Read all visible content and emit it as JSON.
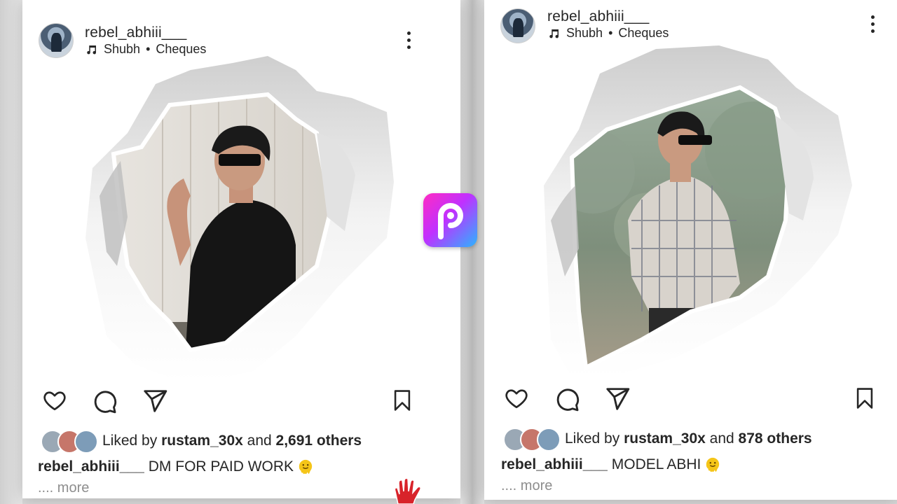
{
  "posts": [
    {
      "username": "rebel_abhiii___",
      "audio_artist": "Shubh",
      "audio_sep": "•",
      "audio_track": "Cheques",
      "liked_prefix": "Liked by",
      "liked_user": "rustam_30x",
      "liked_and": "and",
      "liked_count": "2,691 others",
      "caption_user": "rebel_abhiii___",
      "caption_text": "DM FOR PAID WORK",
      "more_text": ".... more",
      "icons": [
        "heart-icon",
        "comment-icon",
        "share-icon",
        "bookmark-icon",
        "more-vertical-icon",
        "music-icon"
      ]
    },
    {
      "username": "rebel_abhiii___",
      "audio_artist": "Shubh",
      "audio_sep": "•",
      "audio_track": "Cheques",
      "liked_prefix": "Liked by",
      "liked_user": "rustam_30x",
      "liked_and": "and",
      "liked_count": "878 others",
      "caption_user": "rebel_abhiii___",
      "caption_text": "MODEL ABHI",
      "more_text": ".... more",
      "icons": [
        "heart-icon",
        "comment-icon",
        "share-icon",
        "bookmark-icon",
        "more-vertical-icon",
        "music-icon"
      ]
    }
  ],
  "overlay": {
    "logo": "picsart-logo-icon",
    "sticker": "hand-sticker-icon"
  },
  "colors": {
    "text": "#262626",
    "muted": "#8e8e8e",
    "logo_gradient_start": "#ff2bc2",
    "logo_gradient_end": "#2ab5ff"
  }
}
